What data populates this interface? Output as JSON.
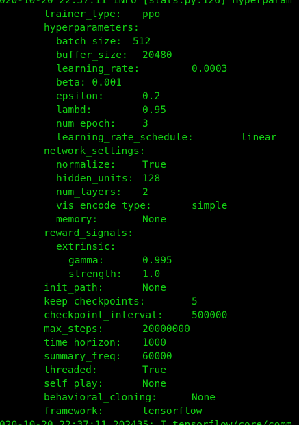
{
  "text_color": "#13d313",
  "background_color": "#000000",
  "lines": [
    {
      "key": "020-10-20 22:37:11 INFO [stats.py:126] Hyperparam",
      "value": ""
    },
    {
      "key": "trainer_type:",
      "value": "ppo"
    },
    {
      "key": "hyperparameters:",
      "value": ""
    },
    {
      "key": "batch_size:",
      "value": "512"
    },
    {
      "key": "buffer_size:",
      "value": "20480"
    },
    {
      "key": "learning_rate:",
      "value": "0.0003"
    },
    {
      "key": "beta: 0.001",
      "value": ""
    },
    {
      "key": "epsilon:",
      "value": "0.2"
    },
    {
      "key": "lambd:",
      "value": "0.95"
    },
    {
      "key": "num_epoch:",
      "value": "3"
    },
    {
      "key": "learning_rate_schedule:",
      "value": "linear"
    },
    {
      "key": "network_settings:",
      "value": ""
    },
    {
      "key": "normalize:",
      "value": "True"
    },
    {
      "key": "hidden_units:",
      "value": "128"
    },
    {
      "key": "num_layers:",
      "value": "2"
    },
    {
      "key": "vis_encode_type:",
      "value": "simple"
    },
    {
      "key": "memory:",
      "value": "None"
    },
    {
      "key": "reward_signals:",
      "value": ""
    },
    {
      "key": "extrinsic:",
      "value": ""
    },
    {
      "key": "gamma:",
      "value": "0.995"
    },
    {
      "key": "strength:",
      "value": "1.0"
    },
    {
      "key": "init_path:",
      "value": "None"
    },
    {
      "key": "keep_checkpoints:",
      "value": "5"
    },
    {
      "key": "checkpoint_interval:",
      "value": "500000"
    },
    {
      "key": "max_steps:",
      "value": "20000000"
    },
    {
      "key": "time_horizon:",
      "value": "1000"
    },
    {
      "key": "summary_freq:",
      "value": "60000"
    },
    {
      "key": "threaded:",
      "value": "True"
    },
    {
      "key": "self_play:",
      "value": "None"
    },
    {
      "key": "behavioral_cloning:",
      "value": "None"
    },
    {
      "key": "framework:",
      "value": "tensorflow"
    },
    {
      "key": "020-10-20 22:37:11.202435: I tensorflow/core/comm",
      "value": ""
    }
  ]
}
